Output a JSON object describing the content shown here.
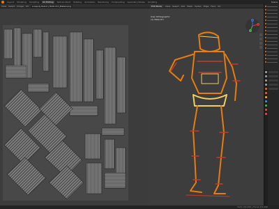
{
  "topbar": {
    "tabs": [
      "Layout",
      "Modeling",
      "Sculpting",
      "UV Editing",
      "Texture Paint",
      "Shading",
      "Animation",
      "Rendering",
      "Compositing",
      "Geometry Nodes",
      "Scripting"
    ],
    "active_tab": "UV Editing",
    "scene_label": "Scene"
  },
  "uv_editor": {
    "header_items": [
      "View",
      "Select",
      "Image",
      "UV"
    ],
    "image_name": "Lowpoly Robot | Multi-Ctrl_Baked.png"
  },
  "viewport": {
    "mode": "Edit Mode",
    "header_items": [
      "View",
      "Select",
      "Add",
      "Mesh",
      "Vertex",
      "Edge",
      "Face",
      "UV"
    ],
    "info_line1": "User Orthographic",
    "info_line2": "(1) Male.Ctrl"
  },
  "gizmo_axes": [
    "X",
    "Y",
    "Z"
  ],
  "statusbar": {
    "text": "Verts 0/9,999 | Faces 0/9,999"
  },
  "colors": {
    "accent": "#e87d0d",
    "uv_bg": "#4a4a4a",
    "wire_orange": "#e87d0d",
    "wire_yellow": "#f0d060",
    "wire_red": "#c83a28"
  }
}
